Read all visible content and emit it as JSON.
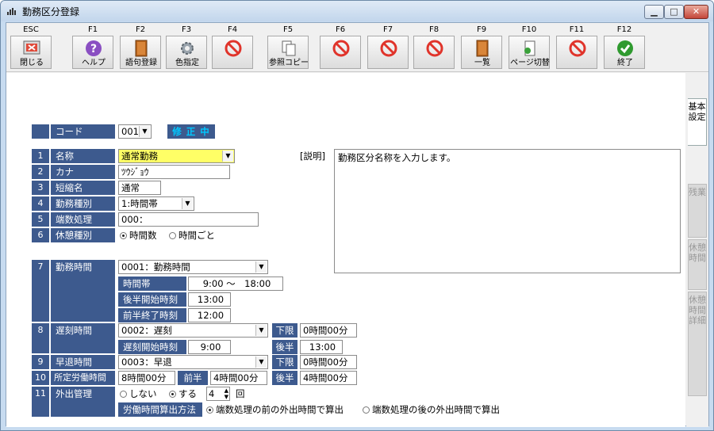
{
  "window": {
    "title": "勤務区分登録",
    "min": "▁",
    "max": "□",
    "close": "✕"
  },
  "toolbar": [
    {
      "key": "ESC",
      "label": "閉じる",
      "icon": "close-window-icon"
    },
    {
      "key": "F1",
      "label": "ヘルプ",
      "icon": "help-icon"
    },
    {
      "key": "F2",
      "label": "語句登録",
      "icon": "book-icon"
    },
    {
      "key": "F3",
      "label": "色指定",
      "icon": "gear-icon"
    },
    {
      "key": "F4",
      "label": "",
      "icon": "disabled-icon"
    },
    {
      "key": "F5",
      "label": "参照コピー",
      "icon": "copy-icon"
    },
    {
      "key": "F6",
      "label": "",
      "icon": "disabled-icon"
    },
    {
      "key": "F7",
      "label": "",
      "icon": "disabled-icon"
    },
    {
      "key": "F8",
      "label": "",
      "icon": "disabled-icon"
    },
    {
      "key": "F9",
      "label": "一覧",
      "icon": "list-book-icon"
    },
    {
      "key": "F10",
      "label": "ページ切替",
      "icon": "page-switch-icon"
    },
    {
      "key": "F11",
      "label": "",
      "icon": "disabled-icon"
    },
    {
      "key": "F12",
      "label": "終了",
      "icon": "check-icon"
    }
  ],
  "form": {
    "code_label": "コード",
    "code_value": "001",
    "mode_badge": "修 正 中",
    "rows": [
      {
        "no": "1",
        "label": "名称",
        "value": "通常勤務"
      },
      {
        "no": "2",
        "label": "カナ",
        "value": "ﾂｳｼﾞｮｳ"
      },
      {
        "no": "3",
        "label": "短縮名",
        "value": "通常"
      },
      {
        "no": "4",
        "label": "勤務種別",
        "value": "1:時間帯"
      },
      {
        "no": "5",
        "label": "端数処理",
        "value": "000："
      },
      {
        "no": "6",
        "label": "休憩種別",
        "opt1": "時間数",
        "opt2": "時間ごと"
      }
    ],
    "description_label": "[説明]",
    "description_text": "勤務区分名称を入力します。",
    "work_time": {
      "no": "7",
      "label": "勤務時間",
      "value": "0001：勤務時間",
      "slot_label": "時間帯",
      "slot_value": "9:00 ～　18:00",
      "second_half_start_label": "後半開始時刻",
      "second_half_start": "13:00",
      "first_half_end_label": "前半終了時刻",
      "first_half_end": "12:00"
    },
    "late": {
      "no": "8",
      "label": "遅刻時間",
      "value": "0002：遅刻",
      "lower_label": "下限",
      "lower_value": "0時間00分",
      "start_label": "遅刻開始時刻",
      "start_value": "9:00",
      "half_label": "後半",
      "half_value": "13:00"
    },
    "early": {
      "no": "9",
      "label": "早退時間",
      "value": "0003：早退",
      "lower_label": "下限",
      "lower_value": "0時間00分"
    },
    "prescribed": {
      "no": "10",
      "label": "所定労働時間",
      "value": "8時間00分",
      "first_label": "前半",
      "first_value": "4時間00分",
      "second_label": "後半",
      "second_value": "4時間00分"
    },
    "outing": {
      "no": "11",
      "label": "外出管理",
      "opt_no": "しない",
      "opt_yes": "する",
      "count": "4",
      "count_unit": "回",
      "method_label": "労働時間算出方法",
      "method_opt1": "端数処理の前の外出時間で算出",
      "method_opt2": "端数処理の後の外出時間で算出"
    }
  },
  "side_tabs": [
    "基本設定",
    "残業",
    "休憩時間",
    "休憩時間詳細"
  ],
  "colors": {
    "label_bg": "#3d5a8e",
    "highlight": "#ffff66",
    "badge_text": "#00b0f0"
  }
}
